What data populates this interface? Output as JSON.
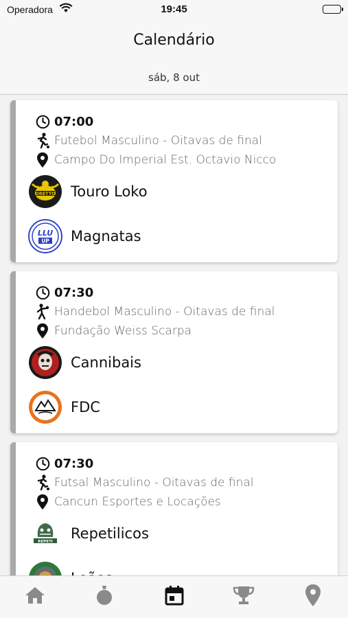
{
  "status_bar": {
    "carrier": "Operadora",
    "time": "19:45"
  },
  "header": {
    "title": "Calendário",
    "date": "sáb, 8 out"
  },
  "games": [
    {
      "time": "07:00",
      "sport": "Futebol Masculino - Oitavas de final",
      "location": "Campo Do Imperial Est. Octavio Nicco",
      "team1": {
        "name": "Touro Loko",
        "logo_icon": "bull-crest-icon"
      },
      "team2": {
        "name": "Magnatas",
        "logo_icon": "up-crest-icon"
      }
    },
    {
      "time": "07:30",
      "sport": "Handebol Masculino - Oitavas de final",
      "location": "Fundação Weiss Scarpa",
      "team1": {
        "name": "Cannibais",
        "logo_icon": "skull-crest-icon"
      },
      "team2": {
        "name": "FDC",
        "logo_icon": "mountain-crest-icon"
      }
    },
    {
      "time": "07:30",
      "sport": "Futsal Masculino - Oitavas de final",
      "location": "Cancun Esportes e Locações",
      "team1": {
        "name": "Repetilicos",
        "logo_icon": "reptile-crest-icon"
      },
      "team2": {
        "name": "Leões",
        "logo_icon": "lion-crest-icon"
      }
    }
  ],
  "tabs": [
    {
      "name": "home",
      "icon": "home-icon",
      "active": false
    },
    {
      "name": "sports",
      "icon": "medal-icon",
      "active": false
    },
    {
      "name": "calendar",
      "icon": "calendar-icon",
      "active": true
    },
    {
      "name": "trophy",
      "icon": "trophy-icon",
      "active": false
    },
    {
      "name": "location",
      "icon": "location-pin-icon",
      "active": false
    }
  ],
  "colors": {
    "active_tab": "#111111",
    "inactive_tab": "#8a8a8a",
    "card_accent": "#a9a9a9"
  }
}
